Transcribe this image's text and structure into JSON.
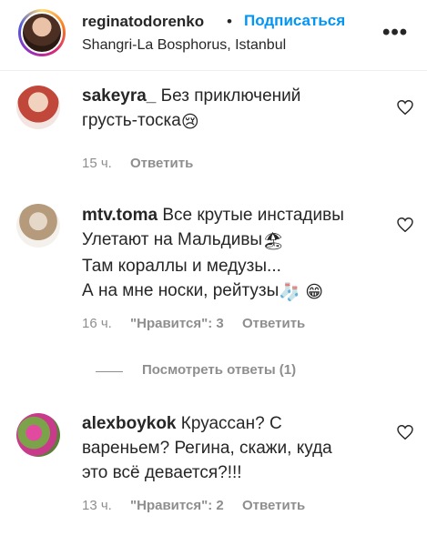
{
  "header": {
    "username": "reginatodorenko",
    "dot": "•",
    "follow_label": "Подписаться",
    "location": "Shangri-La Bosphorus, Istanbul",
    "more_label": "•••"
  },
  "comments": [
    {
      "username": "sakeyra_",
      "lines": [
        "Без приключений",
        "грусть-тоска"
      ],
      "emoji": "😢",
      "time": "15 ч.",
      "likes": "",
      "reply_label": "Ответить"
    },
    {
      "username": "mtv.toma",
      "lines": [
        "Все крутые инстадивы",
        "Улетают на Мальдивы",
        "Там кораллы и медузы...",
        "А на мне носки, рейтузы"
      ],
      "emoji_line2": "🏖",
      "emoji_line4": "🧦 😁",
      "time": "16 ч.",
      "likes": "\"Нравится\": 3",
      "reply_label": "Ответить"
    },
    {
      "username": "alexboykok",
      "lines": [
        "Круассан? С",
        "вареньем? Регина, скажи, куда",
        "это всё девается?!!!"
      ],
      "time": "13 ч.",
      "likes": "\"Нравится\": 2",
      "reply_label": "Ответить"
    }
  ],
  "view_replies": "Посмотреть ответы (1)"
}
